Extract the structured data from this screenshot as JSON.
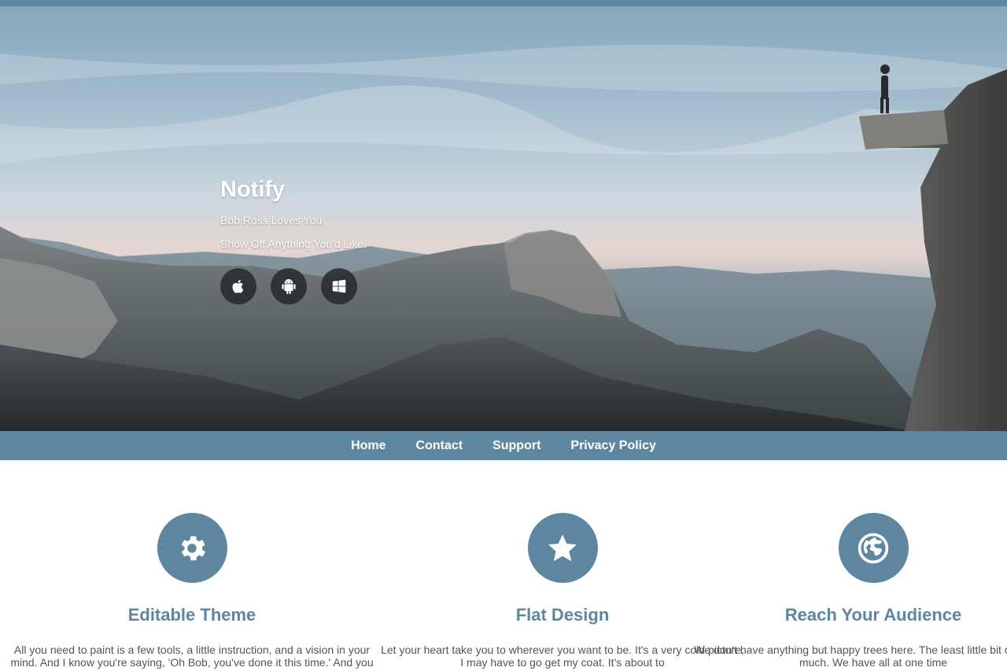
{
  "hero": {
    "title": "Notify",
    "line1": "Bob Ross Loves You",
    "line2": "Show Off Anything You'd Like.",
    "store_buttons": [
      {
        "icon": "apple-icon"
      },
      {
        "icon": "android-icon"
      },
      {
        "icon": "windows-icon"
      }
    ]
  },
  "nav": {
    "items": [
      "Home",
      "Contact",
      "Support",
      "Privacy Policy"
    ]
  },
  "features": [
    {
      "icon": "gear-icon",
      "title": "Editable Theme",
      "text": "All you need to paint is a few tools, a little instruction, and a vision in your mind. And I know you're saying, 'Oh Bob, you've done it this time.' And you"
    },
    {
      "icon": "star-icon",
      "title": "Flat Design",
      "text": "Let your heart take you to wherever you want to be. It's a very cold picture, I may have to go get my coat. It's about to"
    },
    {
      "icon": "globe-icon",
      "title": "Reach Your Audience",
      "text": "We don't have anything but happy trees here. The least little bit can do so much. We have all at one time"
    }
  ],
  "colors": {
    "accent": "#5f86a0",
    "text_on_hero": "#ffffff",
    "button_dark": "#23262a"
  }
}
